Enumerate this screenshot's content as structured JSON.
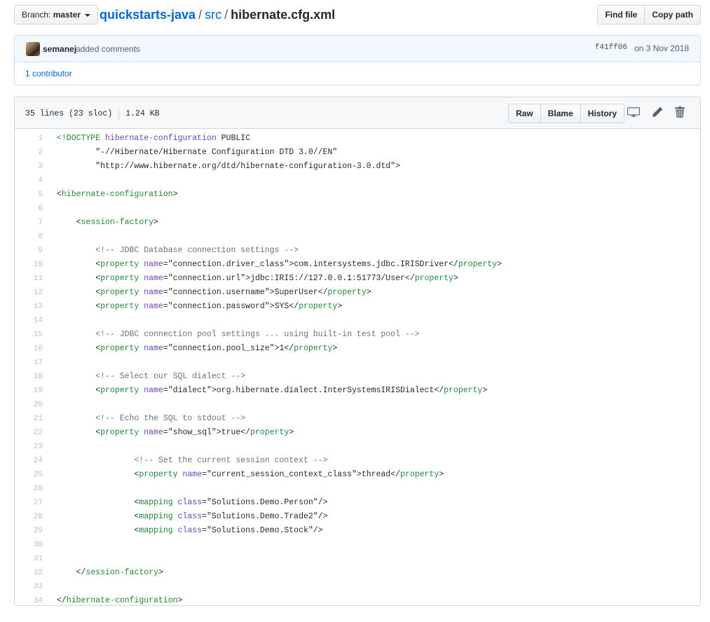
{
  "topbar": {
    "branch_label": "Branch:",
    "branch_name": "master",
    "breadcrumb": {
      "repo": "quickstarts-java",
      "folder": "src",
      "file": "hibernate.cfg.xml",
      "separator": "/"
    },
    "find_file_label": "Find file",
    "copy_path_label": "Copy path"
  },
  "commit": {
    "author": "semanej",
    "message": "added comments",
    "sha": "f41ff06",
    "date": "on 3 Nov 2018",
    "contributors": "1 contributor"
  },
  "file": {
    "lines_info": "35 lines (23 sloc)",
    "size": "1.24 KB",
    "actions": {
      "raw": "Raw",
      "blame": "Blame",
      "history": "History"
    },
    "icons": [
      "desktop-icon",
      "pencil-icon",
      "trash-icon"
    ]
  },
  "code_lines": [
    {
      "n": "1",
      "seg": [
        [
          "tag",
          "<!DOCTYPE "
        ],
        [
          "attr",
          "hibernate-configuration"
        ],
        [
          "plain",
          " PUBLIC"
        ]
      ]
    },
    {
      "n": "2",
      "seg": [
        [
          "plain",
          "        \"-//Hibernate/Hibernate Configuration DTD 3.0//EN\""
        ]
      ]
    },
    {
      "n": "3",
      "seg": [
        [
          "plain",
          "        \"http://www.hibernate.org/dtd/hibernate-configuration-3.0.dtd\">"
        ]
      ]
    },
    {
      "n": "4",
      "seg": []
    },
    {
      "n": "5",
      "seg": [
        [
          "plain",
          "<"
        ],
        [
          "tag",
          "hibernate-configuration"
        ],
        [
          "plain",
          ">"
        ]
      ]
    },
    {
      "n": "6",
      "seg": []
    },
    {
      "n": "7",
      "seg": [
        [
          "plain",
          "    <"
        ],
        [
          "tag",
          "session-factory"
        ],
        [
          "plain",
          ">"
        ]
      ]
    },
    {
      "n": "8",
      "seg": []
    },
    {
      "n": "9",
      "seg": [
        [
          "com",
          "        <!-- JDBC Database connection settings -->"
        ]
      ]
    },
    {
      "n": "10",
      "seg": [
        [
          "plain",
          "        <"
        ],
        [
          "tag",
          "property"
        ],
        [
          "plain",
          " "
        ],
        [
          "attr",
          "name"
        ],
        [
          "plain",
          "=\"connection.driver_class\">com.intersystems.jdbc.IRISDriver</"
        ],
        [
          "tag",
          "property"
        ],
        [
          "plain",
          ">"
        ]
      ]
    },
    {
      "n": "11",
      "seg": [
        [
          "plain",
          "        <"
        ],
        [
          "tag",
          "property"
        ],
        [
          "plain",
          " "
        ],
        [
          "attr",
          "name"
        ],
        [
          "plain",
          "=\"connection.url\">jdbc:IRIS://127.0.0.1:51773/User</"
        ],
        [
          "tag",
          "property"
        ],
        [
          "plain",
          ">"
        ]
      ]
    },
    {
      "n": "12",
      "seg": [
        [
          "plain",
          "        <"
        ],
        [
          "tag",
          "property"
        ],
        [
          "plain",
          " "
        ],
        [
          "attr",
          "name"
        ],
        [
          "plain",
          "=\"connection.username\">SuperUser</"
        ],
        [
          "tag",
          "property"
        ],
        [
          "plain",
          ">"
        ]
      ]
    },
    {
      "n": "13",
      "seg": [
        [
          "plain",
          "        <"
        ],
        [
          "tag",
          "property"
        ],
        [
          "plain",
          " "
        ],
        [
          "attr",
          "name"
        ],
        [
          "plain",
          "=\"connection.password\">SYS</"
        ],
        [
          "tag",
          "property"
        ],
        [
          "plain",
          ">"
        ]
      ]
    },
    {
      "n": "14",
      "seg": []
    },
    {
      "n": "15",
      "seg": [
        [
          "com",
          "        <!-- JDBC connection pool settings ... using built-in test pool -->"
        ]
      ]
    },
    {
      "n": "16",
      "seg": [
        [
          "plain",
          "        <"
        ],
        [
          "tag",
          "property"
        ],
        [
          "plain",
          " "
        ],
        [
          "attr",
          "name"
        ],
        [
          "plain",
          "=\"connection.pool_size\">1</"
        ],
        [
          "tag",
          "property"
        ],
        [
          "plain",
          ">"
        ]
      ]
    },
    {
      "n": "17",
      "seg": []
    },
    {
      "n": "18",
      "seg": [
        [
          "com",
          "        <!-- Select our SQL dialect -->"
        ]
      ]
    },
    {
      "n": "19",
      "seg": [
        [
          "plain",
          "        <"
        ],
        [
          "tag",
          "property"
        ],
        [
          "plain",
          " "
        ],
        [
          "attr",
          "name"
        ],
        [
          "plain",
          "=\"dialect\">org.hibernate.dialect.InterSystemsIRISDialect</"
        ],
        [
          "tag",
          "property"
        ],
        [
          "plain",
          ">"
        ]
      ]
    },
    {
      "n": "20",
      "seg": []
    },
    {
      "n": "21",
      "seg": [
        [
          "com",
          "        <!-- Echo the SQL to stdout -->"
        ]
      ]
    },
    {
      "n": "22",
      "seg": [
        [
          "plain",
          "        <"
        ],
        [
          "tag",
          "property"
        ],
        [
          "plain",
          " "
        ],
        [
          "attr",
          "name"
        ],
        [
          "plain",
          "=\"show_sql\">true</"
        ],
        [
          "tag",
          "property"
        ],
        [
          "plain",
          ">"
        ]
      ]
    },
    {
      "n": "23",
      "seg": []
    },
    {
      "n": "24",
      "seg": [
        [
          "com",
          "                <!-- Set the current session context -->"
        ]
      ]
    },
    {
      "n": "25",
      "seg": [
        [
          "plain",
          "                <"
        ],
        [
          "tag",
          "property"
        ],
        [
          "plain",
          " "
        ],
        [
          "attr",
          "name"
        ],
        [
          "plain",
          "=\"current_session_context_class\">thread</"
        ],
        [
          "tag",
          "property"
        ],
        [
          "plain",
          ">"
        ]
      ]
    },
    {
      "n": "26",
      "seg": []
    },
    {
      "n": "27",
      "seg": [
        [
          "plain",
          "                <"
        ],
        [
          "tag",
          "mapping"
        ],
        [
          "plain",
          " "
        ],
        [
          "attr",
          "class"
        ],
        [
          "plain",
          "=\"Solutions.Demo.Person\"/>"
        ]
      ]
    },
    {
      "n": "28",
      "seg": [
        [
          "plain",
          "                <"
        ],
        [
          "tag",
          "mapping"
        ],
        [
          "plain",
          " "
        ],
        [
          "attr",
          "class"
        ],
        [
          "plain",
          "=\"Solutions.Demo.Trade2\"/>"
        ]
      ]
    },
    {
      "n": "29",
      "seg": [
        [
          "plain",
          "                <"
        ],
        [
          "tag",
          "mapping"
        ],
        [
          "plain",
          " "
        ],
        [
          "attr",
          "class"
        ],
        [
          "plain",
          "=\"Solutions.Demo.Stock\"/>"
        ]
      ]
    },
    {
      "n": "30",
      "seg": []
    },
    {
      "n": "31",
      "seg": []
    },
    {
      "n": "32",
      "seg": [
        [
          "plain",
          "    </"
        ],
        [
          "tag",
          "session-factory"
        ],
        [
          "plain",
          ">"
        ]
      ]
    },
    {
      "n": "33",
      "seg": []
    },
    {
      "n": "34",
      "seg": [
        [
          "plain",
          "</"
        ],
        [
          "tag",
          "hibernate-configuration"
        ],
        [
          "plain",
          ">"
        ]
      ]
    }
  ]
}
